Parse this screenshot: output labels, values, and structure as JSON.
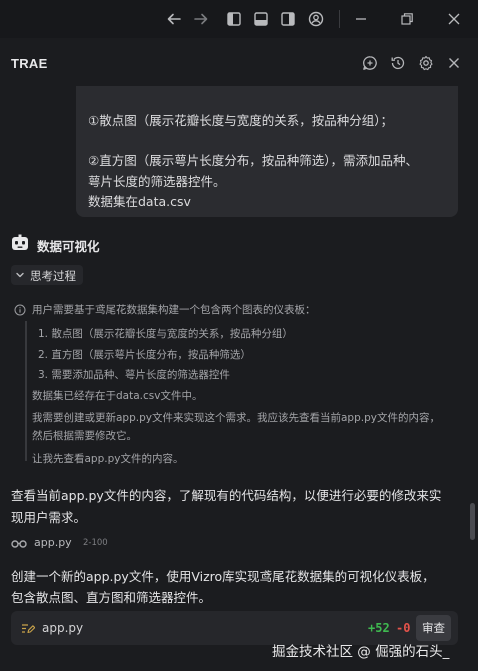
{
  "panel": {
    "title": "TRAE"
  },
  "user_message": {
    "lines": [
      "①散点图（展示花瓣长度与宽度的关系，按品种分组）；",
      "②直方图（展示萼片长度分布，按品种筛选），需添加品种、",
      "萼片长度的筛选器控件。",
      "数据集在data.csv"
    ]
  },
  "agent": {
    "name": "数据可视化"
  },
  "thinking": {
    "toggle_label": "思考过程",
    "intro": "用户需要基于鸢尾花数据集构建一个包含两个图表的仪表板：",
    "items": [
      "1. 散点图（展示花瓣长度与宽度的关系，按品种分组）",
      "2. 直方图（展示萼片长度分布，按品种筛选）",
      "3. 需要添加品种、萼片长度的筛选器控件"
    ],
    "p1": "数据集已经存在于data.csv文件中。",
    "p2a": "我需要创建或更新app.py文件来实现这个需求。我应该先查看当前app.py文件的内容，",
    "p2b": "然后根据需要修改它。",
    "p3": "让我先查看app.py文件的内容。"
  },
  "reply1": {
    "line1": "查看当前app.py文件的内容，了解现有的代码结构，以便进行必要的修改来实",
    "line2": "现用户需求。"
  },
  "file_ref": {
    "name": "app.py",
    "range": "2-100",
    "icon": "glasses-icon"
  },
  "reply2": {
    "line1": "创建一个新的app.py文件，使用Vizro库实现鸢尾花数据集的可视化仪表板，",
    "line2": "包含散点图、直方图和筛选器控件。"
  },
  "file_card": {
    "name": "app.py",
    "additions": "+52",
    "deletions": "-0",
    "review_label": "审查",
    "icon": "edit-file-icon"
  },
  "watermark": "掘金技术社区 @ 倔强的石头_",
  "colors": {
    "add": "#3fb950",
    "del": "#e5534b",
    "bg": "#1b1c1f",
    "bubble": "#2b2c30"
  }
}
